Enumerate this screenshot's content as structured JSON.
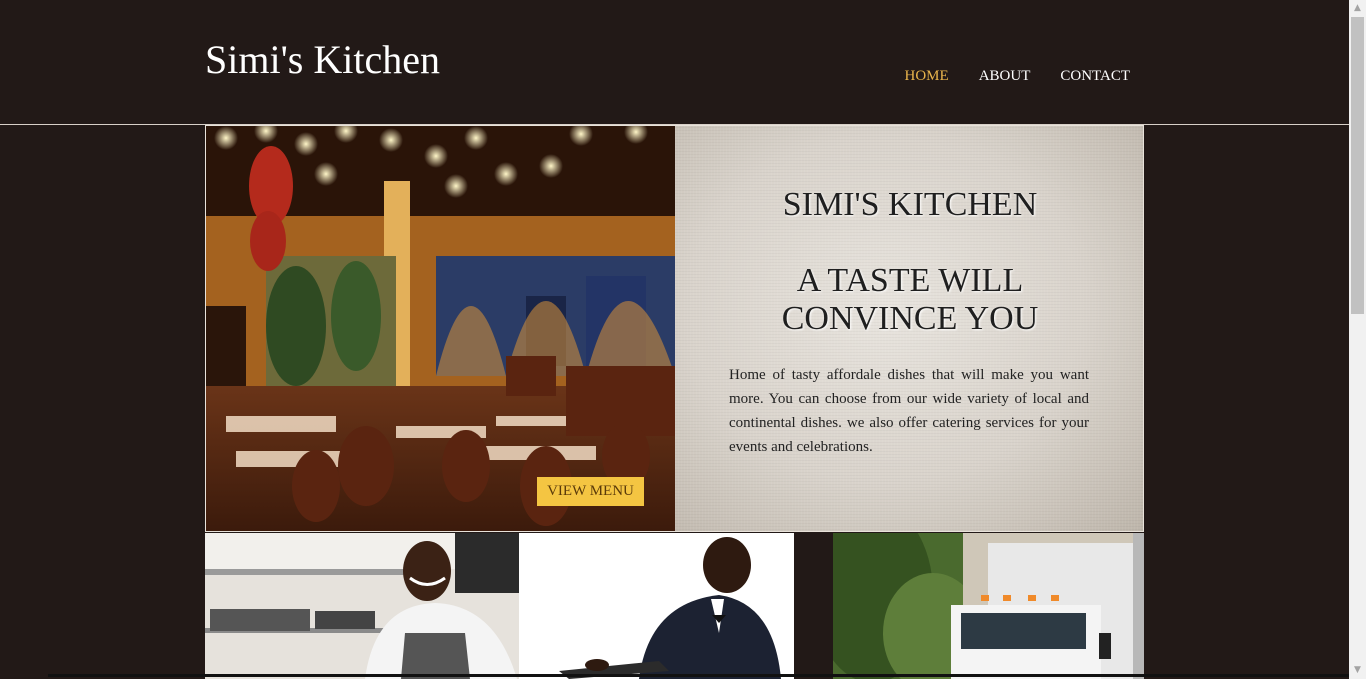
{
  "header": {
    "brand": "Simi's Kitchen",
    "nav": [
      {
        "label": "HOME",
        "active": true
      },
      {
        "label": "ABOUT",
        "active": false
      },
      {
        "label": "CONTACT",
        "active": false
      }
    ]
  },
  "hero": {
    "title": "SIMI'S KITCHEN",
    "tagline": "A TASTE WILL CONVINCE YOU",
    "description": "Home of tasty affordale dishes that will make you want more. You can choose from our wide variety of local and continental dishes. we also offer catering services for your events and celebrations.",
    "button_label": "VIEW MENU"
  },
  "colors": {
    "background": "#221917",
    "nav_active": "#e9b54c",
    "button": "#f4c542"
  },
  "thumbnails": [
    {
      "name": "chef-photo"
    },
    {
      "name": "waiter-photo"
    },
    {
      "name": "delivery-truck-photo"
    }
  ]
}
